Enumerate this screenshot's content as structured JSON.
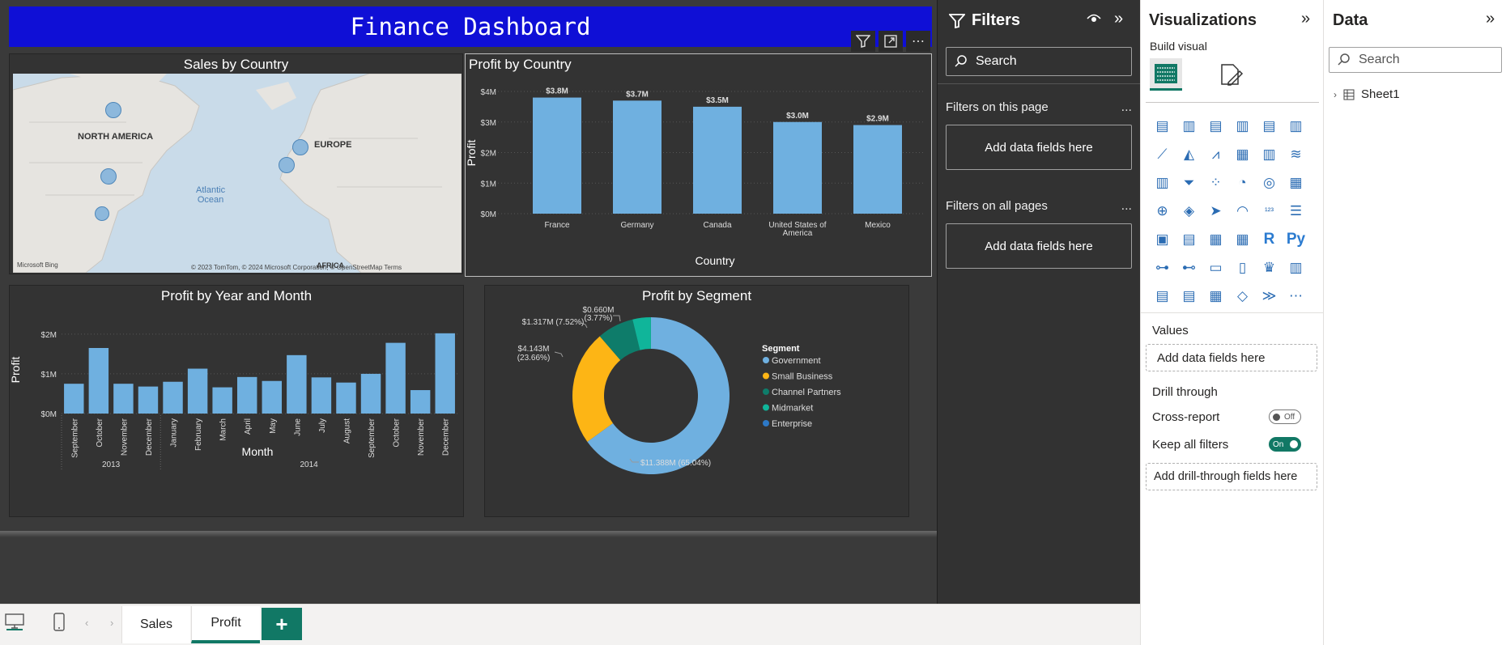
{
  "dashboard_title": "Finance Dashboard",
  "colors": {
    "bar": "#6fb0e0",
    "title_bg": "#0f0fd6",
    "canvas": "#3a3a3a",
    "accent": "#117865"
  },
  "visual_toolbar": [
    "filter-icon",
    "focus-mode-icon",
    "more-options-icon"
  ],
  "map_visual": {
    "title": "Sales by Country",
    "labels": {
      "na": "NORTH AMERICA",
      "eu": "EUROPE",
      "ocean_1": "Atlantic",
      "ocean_2": "Ocean",
      "africa": "AFRICA"
    },
    "credit_left": "Microsoft Bing",
    "credit_right": "© 2023 TomTom, © 2024 Microsoft Corporation, © OpenStreetMap  Terms"
  },
  "chart_data": [
    {
      "type": "bar",
      "title": "Profit by Country",
      "xlabel": "Country",
      "ylabel": "Profit",
      "categories": [
        "France",
        "Germany",
        "Canada",
        "United States of America",
        "Mexico"
      ],
      "values": [
        3.8,
        3.7,
        3.5,
        3.0,
        2.9
      ],
      "data_labels": [
        "$3.8M",
        "$3.7M",
        "$3.5M",
        "$3.0M",
        "$2.9M"
      ],
      "yticks": [
        "$0M",
        "$1M",
        "$2M",
        "$3M",
        "$4M"
      ],
      "ylim": [
        0,
        4
      ],
      "grid": true
    },
    {
      "type": "bar",
      "title": "Profit by Year and Month",
      "xlabel": "Month",
      "ylabel": "Profit",
      "categories": [
        "September",
        "October",
        "November",
        "December",
        "January",
        "February",
        "March",
        "April",
        "May",
        "June",
        "July",
        "August",
        "September",
        "October",
        "November",
        "December"
      ],
      "years": [
        {
          "label": "2013",
          "count": 4
        },
        {
          "label": "2014",
          "count": 12
        }
      ],
      "values": [
        0.75,
        1.65,
        0.75,
        0.68,
        0.8,
        1.13,
        0.66,
        0.92,
        0.82,
        1.47,
        0.91,
        0.78,
        1.0,
        1.78,
        0.59,
        2.02
      ],
      "yticks": [
        "$0M",
        "$1M",
        "$2M"
      ],
      "ylim": [
        0,
        2.2
      ],
      "grid": true
    },
    {
      "type": "pie",
      "title": "Profit by Segment",
      "legend_title": "Segment",
      "legend_position": "right",
      "slices": [
        {
          "name": "Government",
          "value": 11.388,
          "label_1": "$11.388M (65.04%)",
          "label_2": "",
          "color": "#6fb0e0"
        },
        {
          "name": "Small Business",
          "value": 4.143,
          "label_1": "$4.143M",
          "label_2": "(23.66%)",
          "color": "#fdb515"
        },
        {
          "name": "Channel Partners",
          "value": 1.317,
          "label_1": "$1.317M (7.52%)",
          "label_2": "",
          "color": "#0e7c6a"
        },
        {
          "name": "Midmarket",
          "value": 0.66,
          "label_1": "$0.660M",
          "label_2": "(3.77%)",
          "color": "#10b59a"
        },
        {
          "name": "Enterprise",
          "value": 0.002,
          "label_1": "",
          "label_2": "",
          "color": "#2d79c7"
        }
      ]
    }
  ],
  "pages": {
    "tab1": "Sales",
    "tab2": "Profit",
    "add": "+"
  },
  "filters_pane": {
    "title": "Filters",
    "search_placeholder": "Search",
    "this_page": "Filters on this page",
    "all_pages": "Filters on all pages",
    "drop_text": "Add data fields here",
    "more": "..."
  },
  "viz_pane": {
    "title": "Visualizations",
    "build_visual": "Build visual",
    "values_label": "Values",
    "values_drop": "Add data fields here",
    "drill_through": "Drill through",
    "cross_report": "Cross-report",
    "cross_report_state": "Off",
    "keep_filters": "Keep all filters",
    "keep_filters_state": "On",
    "drill_drop": "Add drill-through fields here",
    "icons": [
      "▤",
      "▥",
      "▤",
      "▥",
      "▤",
      "▥",
      "⟋",
      "◭",
      "⩘",
      "▦",
      "▥",
      "≋",
      "▥",
      "⏷",
      "⁘",
      "◔",
      "◎",
      "▦",
      "⊕",
      "◈",
      "➤",
      "◠",
      "¹²³",
      "☰",
      "▣",
      "▤",
      "▦",
      "▦",
      "R",
      "Py",
      "⊶",
      "⊷",
      "▭",
      "▯",
      "♛",
      "▥",
      "▤",
      "▤",
      "▦",
      "◇",
      "≫",
      "⋯"
    ]
  },
  "data_pane": {
    "title": "Data",
    "search_placeholder": "Search",
    "tables": [
      "Sheet1"
    ]
  }
}
